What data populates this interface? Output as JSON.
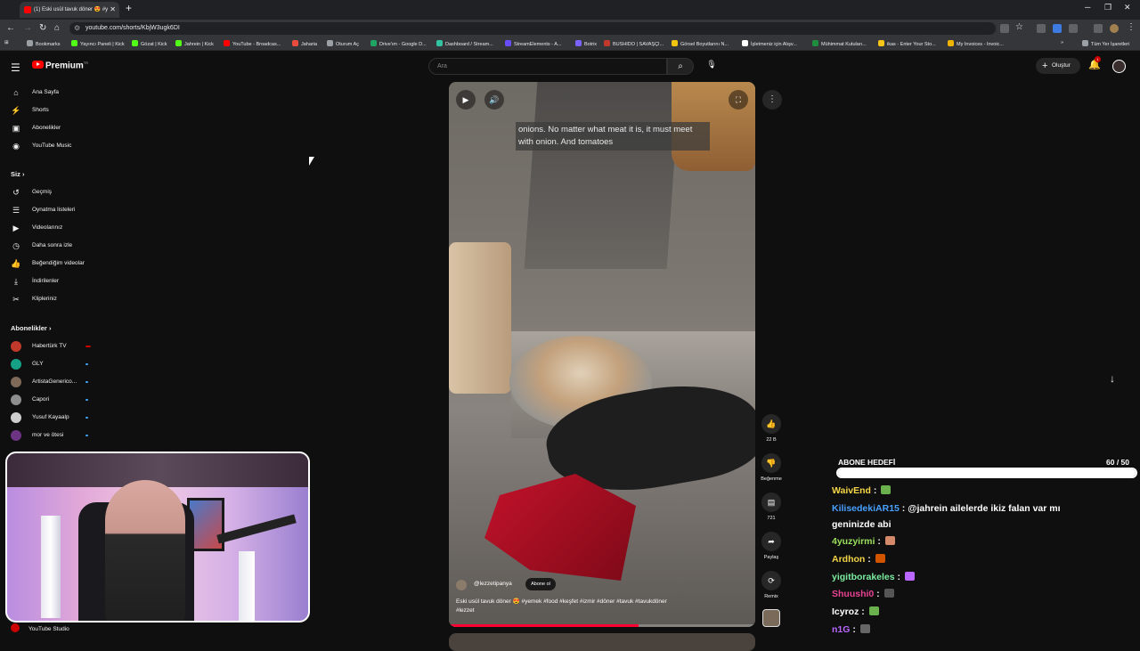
{
  "browser": {
    "tab_title": "(1) Eski usül tavuk döner 😍 #y",
    "tab_close": "✕",
    "new_tab": "+",
    "window_controls": [
      "─",
      "❐",
      "✕"
    ],
    "url": "youtube.com/shorts/KbjW3ugk6DI",
    "bookmarks": [
      {
        "label": "Bookmarks",
        "color": "#9aa0a6"
      },
      {
        "label": "Yayıncı Paneli | Kick",
        "color": "#53fc18"
      },
      {
        "label": "Gözat | Kick",
        "color": "#53fc18"
      },
      {
        "label": "Jahrein | Kick",
        "color": "#53fc18"
      },
      {
        "label": "YouTube - Broadcas...",
        "color": "#ff0000"
      },
      {
        "label": "Jaharia",
        "color": "#e84c3d"
      },
      {
        "label": "Oturum Aç",
        "color": "#9aa0a6"
      },
      {
        "label": "Drive'ım - Google D...",
        "color": "#1fa463"
      },
      {
        "label": "Dashboard / Stream...",
        "color": "#31c3a2"
      },
      {
        "label": "StreamElements - A...",
        "color": "#6a4cff"
      },
      {
        "label": "Botrix",
        "color": "#7b61ff"
      },
      {
        "label": "BUSHIDO | SAVAŞÇI...",
        "color": "#c0392b"
      },
      {
        "label": "Görsel Boyutlarını N...",
        "color": "#f1c40f"
      },
      {
        "label": "İşletmeniz için Alışv...",
        "color": "#ffffff"
      },
      {
        "label": "Mühimmat Kutuları...",
        "color": "#1e8e3e"
      },
      {
        "label": "ikas - Enter Your Sto...",
        "color": "#f5c518"
      },
      {
        "label": "My Invoices - Invoic...",
        "color": "#f0b400"
      }
    ],
    "more_bookmarks": "»",
    "all_bookmarks": "Tüm Yer İşaretleri"
  },
  "header": {
    "logo_text": "Premium",
    "logo_sup": "TR",
    "search_placeholder": "Ara",
    "create_label": "Oluştur",
    "notification_count": "1"
  },
  "sidebar": {
    "main": [
      {
        "label": "Ana Sayfa",
        "icon": "home-icon",
        "glyph": "⌂"
      },
      {
        "label": "Shorts",
        "icon": "shorts-icon",
        "glyph": "⚡"
      },
      {
        "label": "Abonelikler",
        "icon": "subscriptions-icon",
        "glyph": "▣"
      },
      {
        "label": "YouTube Music",
        "icon": "music-icon",
        "glyph": "◉"
      }
    ],
    "you_header": "Siz",
    "you_items": [
      {
        "label": "Geçmiş",
        "icon": "history-icon",
        "glyph": "↺"
      },
      {
        "label": "Oynatma listeleri",
        "icon": "playlists-icon",
        "glyph": "☰"
      },
      {
        "label": "Videolarınız",
        "icon": "your-videos-icon",
        "glyph": "▶"
      },
      {
        "label": "Daha sonra izle",
        "icon": "watch-later-icon",
        "glyph": "◷"
      },
      {
        "label": "Beğendiğim videolar",
        "icon": "liked-icon",
        "glyph": "👍"
      },
      {
        "label": "İndirilenler",
        "icon": "downloads-icon",
        "glyph": "⤓"
      },
      {
        "label": "Klipleriniz",
        "icon": "clips-icon",
        "glyph": "✂"
      }
    ],
    "subs_header": "Abonelikler",
    "subs": [
      {
        "label": "Habertürk TV",
        "color": "#c0392b",
        "live": true
      },
      {
        "label": "GLY",
        "color": "#16a085",
        "live": false
      },
      {
        "label": "ArtistaGenerico...",
        "color": "#7f6a5a",
        "live": false
      },
      {
        "label": "Capori",
        "color": "#8e8e8e",
        "live": false
      },
      {
        "label": "Yusuf Kayaalp",
        "color": "#cfcfcf",
        "live": false
      },
      {
        "label": "mor ve ötesi",
        "color": "#6c3483",
        "live": false
      }
    ],
    "studio_label": "YouTube Studio"
  },
  "short": {
    "caption": "onions.  No matter what meat it is, it must meet with onion.  And tomatoes",
    "channel": "@lezzetipanya",
    "subscribe_label": "Abone ol",
    "description": "Eski usül tavuk döner 😍",
    "hashtags": "#yemek #food #keşfet #izmir #döner #tavuk #tavukdöner #lezzet",
    "progress": 0.62
  },
  "actions": {
    "likes": "22 B",
    "dislike_label": "Beğenme",
    "comments": "721",
    "share_label": "Paylaş",
    "remix_label": "Remix"
  },
  "overlay": {
    "goal_title": "ABONE HEDEFİ",
    "goal_count": "60 / 50",
    "goal_fraction": 1.0,
    "chat": [
      {
        "user": "WaivEnd",
        "color": "#f5d547",
        "msg": "",
        "emote": "#6ab04c"
      },
      {
        "user": "KilisedekiAR15",
        "color": "#48a0ff",
        "msg": "@jahrein ailelerde ikiz falan var mı",
        "emote": ""
      },
      {
        "user": "",
        "color": "#ffffff",
        "msg": "geninizde abi",
        "emote": ""
      },
      {
        "user": "4yuzyirmi",
        "color": "#9be15d",
        "msg": "",
        "emote": "#d48a6a"
      },
      {
        "user": "Ardhon",
        "color": "#f5d547",
        "msg": "",
        "emote": "#d35400"
      },
      {
        "user": "yigitborakeles",
        "color": "#7bed9f",
        "msg": "",
        "emote": "#b967ff"
      },
      {
        "user": "Shuushi0",
        "color": "#e84393",
        "msg": "",
        "emote": "#555555"
      },
      {
        "user": "Icyroz",
        "color": "#ffffff",
        "msg": "",
        "emote": "#6ab04c"
      },
      {
        "user": "n1G",
        "color": "#b967ff",
        "msg": "",
        "emote": "#666666"
      }
    ]
  }
}
